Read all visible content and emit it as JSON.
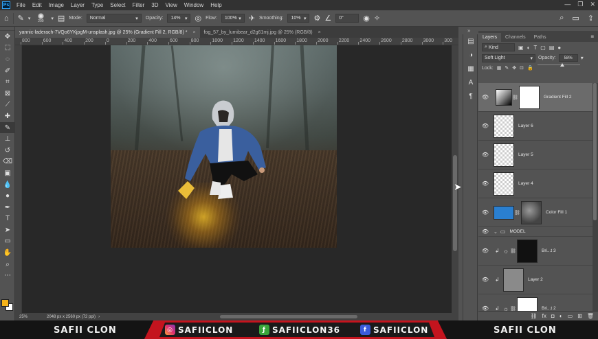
{
  "menubar": {
    "logo": "Ps",
    "items": [
      "File",
      "Edit",
      "Image",
      "Layer",
      "Type",
      "Select",
      "Filter",
      "3D",
      "View",
      "Window",
      "Help"
    ],
    "window_controls": [
      "—",
      "❐",
      "✕"
    ]
  },
  "options": {
    "brush_size": "200",
    "mode_label": "Mode:",
    "mode_value": "Normal",
    "opacity_label": "Opacity:",
    "opacity_value": "14%",
    "flow_label": "Flow:",
    "flow_value": "100%",
    "smoothing_label": "Smoothing:",
    "smoothing_value": "10%",
    "angle_value": "0°"
  },
  "tabs": [
    {
      "label": "yannic-laderach-7VQo6YKjpgM-unsplash.jpg @ 25% (Gradient Fill 2, RGB/8) *",
      "close": "×"
    },
    {
      "label": "fog_57_by_lumibear_d2g61mj.jpg @ 25% (RGB/8)",
      "close": "×"
    }
  ],
  "ruler": {
    "labels": [
      "800",
      "600",
      "400",
      "200",
      "0",
      "200",
      "400",
      "600",
      "800",
      "1000",
      "1200",
      "1400",
      "1600",
      "1800",
      "2000",
      "2200",
      "2400",
      "2600",
      "2800",
      "3000",
      "300"
    ]
  },
  "status": {
    "zoom": "25%",
    "doc_info": "2048 px x 2560 px (72 ppi)"
  },
  "panel": {
    "tabs": [
      "Layers",
      "Channels",
      "Paths"
    ],
    "kind": "Kind",
    "blend_mode": "Soft Light",
    "opacity_label": "Opacity:",
    "opacity_value": "58%",
    "opacity_fraction": 0.58,
    "lock_label": "Lock:",
    "fill_label": "Fill:",
    "fill_value": "100%"
  },
  "layers": [
    {
      "name": "Gradient Fill 2",
      "selected": true
    },
    {
      "name": "Layer 6"
    },
    {
      "name": "Layer 5"
    },
    {
      "name": "Layer 4"
    },
    {
      "name": "Color Fill 1"
    },
    {
      "name": "MODEL"
    },
    {
      "name": "Bri...t 3"
    },
    {
      "name": "Layer 2"
    },
    {
      "name": "Bri...t 2"
    }
  ],
  "banner": {
    "left_name": "SAFII CLON",
    "instagram": "SAFIICLON",
    "fiverr": "SAFIICLON36",
    "facebook": "SAFIICLON",
    "right_name": "SAFII CLON"
  },
  "colors": {
    "foreground": "#f5b31a",
    "background": "#ffffff",
    "banner_red": "#c4141e"
  },
  "icons": {
    "home": "home-icon",
    "brush": "brush-icon",
    "search": "search-icon",
    "workspace": "workspace-icon",
    "share": "share-icon"
  }
}
